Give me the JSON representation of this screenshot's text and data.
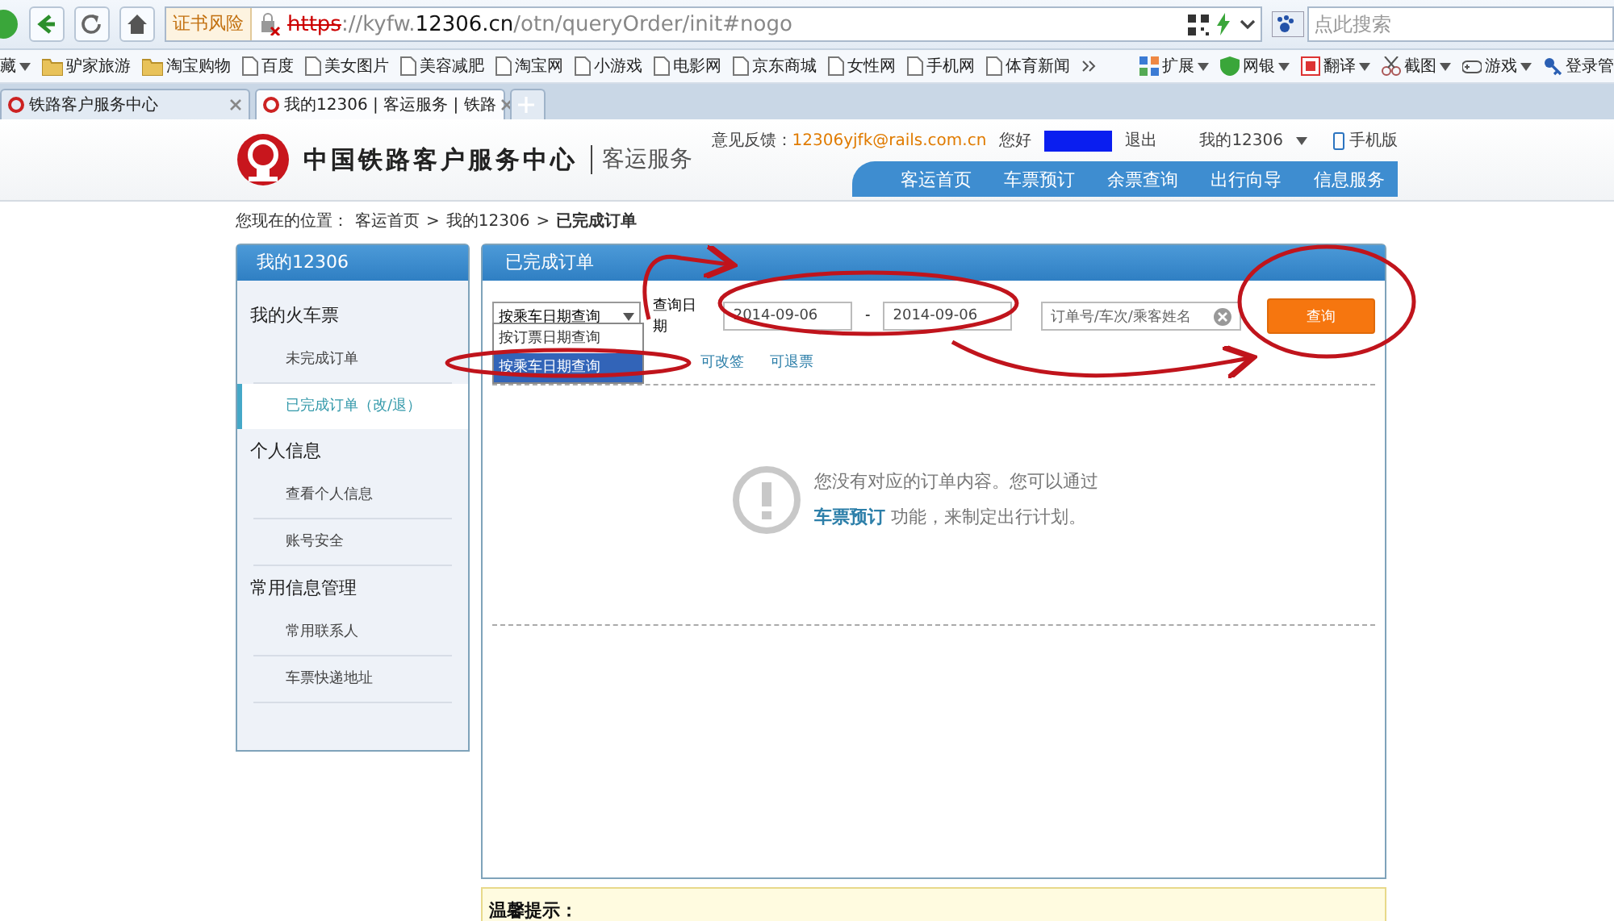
{
  "browser": {
    "security_badge": "证书风险",
    "url_scheme": "https",
    "url_host_prefix": "://kyfw.",
    "url_host": "12306.cn",
    "url_path": "/otn/queryOrder/init#nogo",
    "search_placeholder": "点此搜索",
    "bookmarks": [
      {
        "label": "藏",
        "kind": "menu"
      },
      {
        "label": "驴家旅游",
        "kind": "folder"
      },
      {
        "label": "淘宝购物",
        "kind": "folder"
      },
      {
        "label": "百度",
        "kind": "page"
      },
      {
        "label": "美女图片",
        "kind": "page"
      },
      {
        "label": "美容减肥",
        "kind": "page"
      },
      {
        "label": "淘宝网",
        "kind": "page"
      },
      {
        "label": "小游戏",
        "kind": "page"
      },
      {
        "label": "电影网",
        "kind": "page"
      },
      {
        "label": "京东商城",
        "kind": "page"
      },
      {
        "label": "女性网",
        "kind": "page"
      },
      {
        "label": "手机网",
        "kind": "page"
      },
      {
        "label": "体育新闻",
        "kind": "page"
      }
    ],
    "tools": [
      {
        "label": "扩展"
      },
      {
        "label": "网银"
      },
      {
        "label": "翻译"
      },
      {
        "label": "截图"
      },
      {
        "label": "游戏"
      },
      {
        "label": "登录管"
      }
    ],
    "tabs": [
      {
        "title": "铁路客户服务中心",
        "selected": false
      },
      {
        "title": "我的12306 | 客运服务 | 铁路",
        "selected": true
      }
    ]
  },
  "header": {
    "site_name": "中国铁路客户服务中心",
    "subtitle": "客运服务",
    "feedback_label": "意见反馈：",
    "feedback_email": "12306yjfk@rails.com.cn",
    "greeting": "您好",
    "logout": "退出",
    "account_menu": "我的12306",
    "mobile": "手机版",
    "nav": [
      "客运首页",
      "车票预订",
      "余票查询",
      "出行向导",
      "信息服务"
    ]
  },
  "breadcrumb": {
    "prefix": "您现在的位置：",
    "items": [
      "客运首页",
      "我的12306"
    ],
    "separators": [
      ">",
      ">"
    ],
    "current": "已完成订单"
  },
  "sidebar": {
    "title": "我的12306",
    "groups": [
      {
        "label": "我的火车票",
        "items": [
          {
            "label": "未完成订单",
            "selected": false
          },
          {
            "label": "已完成订单（改/退）",
            "selected": true
          }
        ]
      },
      {
        "label": "个人信息",
        "items": [
          {
            "label": "查看个人信息",
            "selected": false
          },
          {
            "label": "账号安全",
            "selected": false
          }
        ]
      },
      {
        "label": "常用信息管理",
        "items": [
          {
            "label": "常用联系人",
            "selected": false
          },
          {
            "label": "车票快递地址",
            "selected": false
          }
        ]
      }
    ]
  },
  "panel": {
    "title": "已完成订单",
    "query_type": "按乘车日期查询",
    "query_options": [
      {
        "label": "按订票日期查询",
        "selected": false
      },
      {
        "label": "按乘车日期查询",
        "selected": true
      }
    ],
    "date_label": "查询日期",
    "start_date": "2014-09-06",
    "date_separator": "-",
    "end_date": "2014-09-06",
    "search_placeholder": "订单号/车次/乘客姓名",
    "search_button": "查询",
    "filters": [
      {
        "label": "可改签",
        "selected": false
      },
      {
        "label": "可退票",
        "selected": false
      }
    ],
    "empty_message": "您没有对应的订单内容。您可以通过",
    "empty_link": "车票预订",
    "empty_message_end": " 功能，来制定出行计划。"
  },
  "tip": {
    "title": "温馨提示："
  }
}
